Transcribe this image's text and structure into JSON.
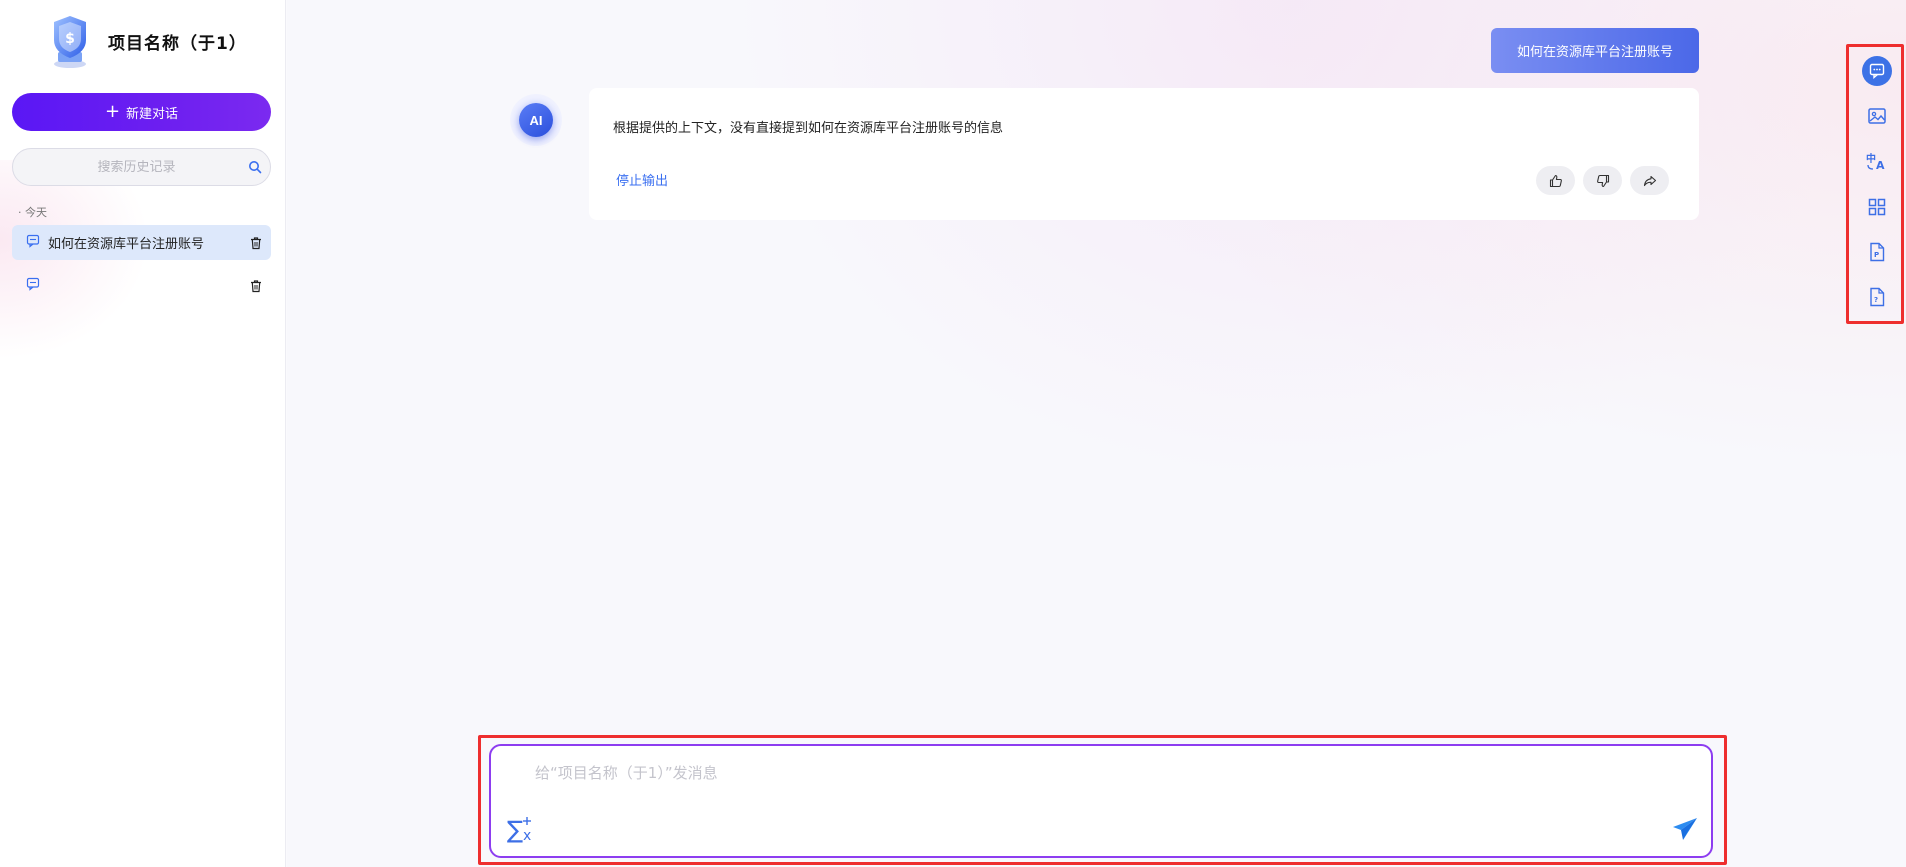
{
  "app": {
    "title": "项目名称（于1）",
    "logo_icon": "shield-logo-icon",
    "accent_color": "#5a17f5",
    "link_color": "#3a6ff0"
  },
  "sidebar": {
    "new_chat_label": "新建对话",
    "search_placeholder": "搜索历史记录",
    "group_label": "· 今天",
    "history": [
      {
        "label": "如何在资源库平台注册账号",
        "active": true
      },
      {
        "label": "",
        "active": false
      }
    ]
  },
  "chat": {
    "user_message": "如何在资源库平台注册账号",
    "ai_avatar_text": "AI",
    "ai_message": "根据提供的上下文，没有直接提到如何在资源库平台注册账号的信息",
    "stop_label": "停止输出",
    "actions": [
      "thumbs-up-icon",
      "thumbs-down-icon",
      "share-icon"
    ]
  },
  "right_toolbar": {
    "tools": [
      {
        "icon": "chat-icon",
        "active": true
      },
      {
        "icon": "image-icon",
        "active": false
      },
      {
        "icon": "translate-icon",
        "active": false
      },
      {
        "icon": "grid-apps-icon",
        "active": false
      },
      {
        "icon": "ppt-file-icon",
        "active": false
      },
      {
        "icon": "help-file-icon",
        "active": false
      }
    ]
  },
  "composer": {
    "placeholder": "给“项目名称（于1）”发消息",
    "formula_icon": "formula-icon",
    "send_icon": "send-icon",
    "border_color": "#8d3df0"
  }
}
